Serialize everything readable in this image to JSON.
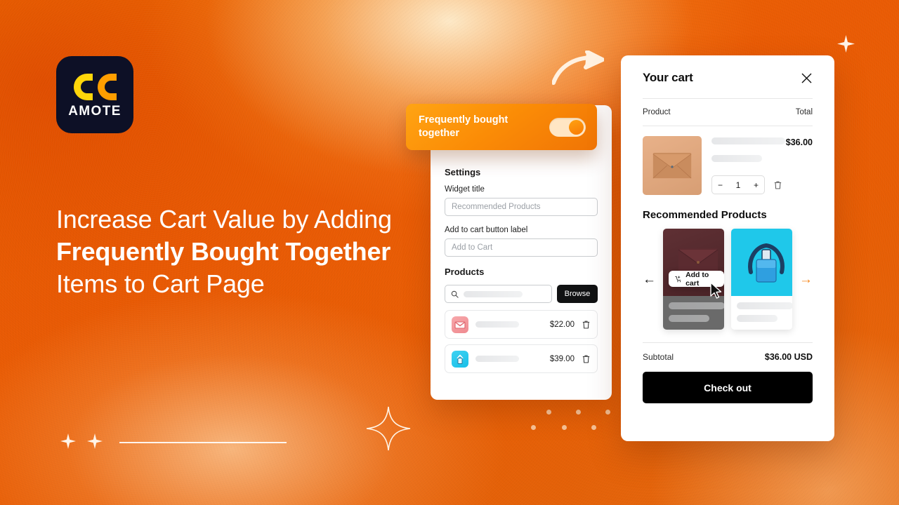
{
  "brand": {
    "wordmark": "AMOTE",
    "logo_icon": "double-quote-icon",
    "logo_bg": "#0d1026",
    "quote_color_1": "#ffd60a",
    "quote_color_2": "#ff9e00"
  },
  "headline": {
    "line1": "Increase Cart Value by Adding",
    "line2": "Frequently Bought Together",
    "line3": "Items to Cart Page"
  },
  "background": {
    "accent": "#e85d04",
    "highlight": "#ffd69a"
  },
  "fbt_card": {
    "label": "Frequently bought together",
    "toggle_state": "on",
    "toggle_track_color": "#ffe6c4",
    "toggle_knob_color": "#f97a05"
  },
  "settings": {
    "section_title": "Settings",
    "widget_title_label": "Widget title",
    "widget_title_placeholder": "Recommended Products",
    "widget_title_value": "",
    "button_label_label": "Add to cart button label",
    "button_label_placeholder": "Add to Cart",
    "button_label_value": "",
    "products_title": "Products",
    "search_placeholder": "",
    "browse_label": "Browse",
    "product_rows": [
      {
        "price": "$22.00",
        "thumb": "envelope-icon",
        "thumb_color": "#ef8a90",
        "delete_icon": "trash-icon"
      },
      {
        "price": "$39.00",
        "thumb": "bag-icon",
        "thumb_color": "#18bfe8",
        "delete_icon": "trash-icon"
      }
    ]
  },
  "cart": {
    "title": "Your cart",
    "close_icon": "close-icon",
    "col_product": "Product",
    "col_total": "Total",
    "item": {
      "price": "$36.00",
      "quantity": "1",
      "decrease_label": "−",
      "increase_label": "+",
      "delete_icon": "trash-icon",
      "thumb": "envelope-icon"
    },
    "recommended_title": "Recommended Products",
    "add_to_cart_label": "Add to cart",
    "add_to_cart_icon": "cart-plus-icon",
    "prev_arrow": "←",
    "next_arrow": "→",
    "next_arrow_color": "#f7861a",
    "rec_cards": [
      {
        "image": "maroon-envelope-image",
        "state": "hovered"
      },
      {
        "image": "cyan-bag-image",
        "state": "default"
      }
    ],
    "subtotal_label": "Subtotal",
    "subtotal_value": "$36.00 USD",
    "checkout_label": "Check out"
  }
}
